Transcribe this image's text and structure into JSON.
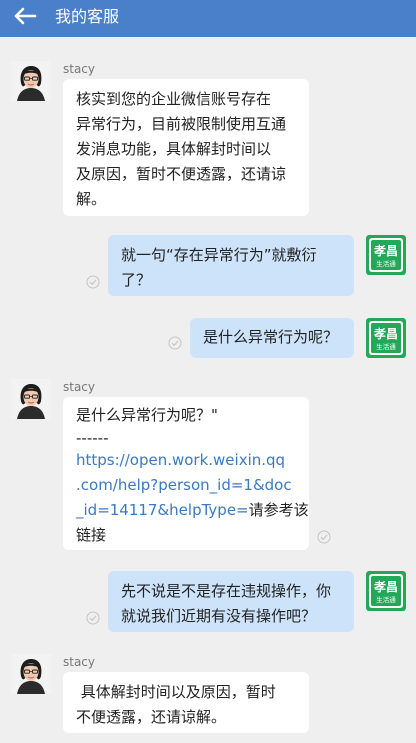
{
  "header": {
    "title": "我的客服",
    "back_icon": "arrow-left-icon"
  },
  "agent_name": "stacy",
  "messages": [
    {
      "from": "agent",
      "sender": "stacy",
      "lines": [
        "核实到您的企业微信账号存在",
        "异常行为，目前被限制使用互通",
        "发消息功能，具体解封时间以",
        "及原因，暂时不便透露，还请谅",
        "解。"
      ]
    },
    {
      "from": "user",
      "lines": [
        "就一句“存在异常行为”就敷衍",
        "了？"
      ],
      "status_icon": "check-circle-icon"
    },
    {
      "from": "user",
      "lines": [
        "是什么异常行为呢？"
      ],
      "status_icon": "check-circle-icon"
    },
    {
      "from": "agent",
      "sender": "stacy",
      "lines": [
        "是什么异常行为呢？\"",
        "------"
      ],
      "link_lines": [
        "https://open.work.weixin.qq",
        ".com/help?person_id=1&doc",
        "_id=14117&helpType="
      ],
      "after_link": "请参考该",
      "tail_lines": [
        "链接"
      ],
      "status_icon": "check-circle-icon"
    },
    {
      "from": "user",
      "lines": [
        "先不说是不是存在违规操作，你",
        "就说我们近期有没有操作吧？"
      ],
      "status_icon": "check-circle-icon"
    },
    {
      "from": "agent",
      "sender": "stacy",
      "lines": [
        " 具体解封时间以及原因，暂时",
        "不便透露，还请谅解。"
      ]
    }
  ],
  "user_avatar": {
    "line1": "孝昌",
    "line2": "生活通",
    "color": "#23a85a"
  },
  "colors": {
    "header": "#4a7fc9",
    "incoming": "#ffffff",
    "outgoing": "#cde3f9",
    "link": "#3a79c4"
  }
}
